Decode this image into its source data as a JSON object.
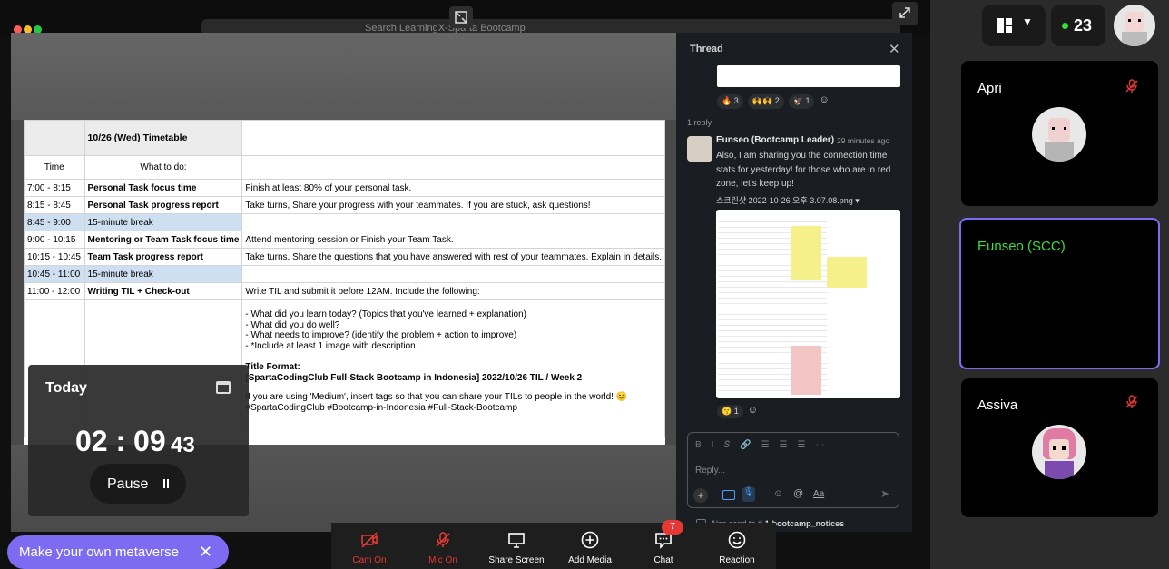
{
  "browser": {
    "address": "Search LearningX-Sparta Bootcamp"
  },
  "sheet": {
    "title": "10/26 (Wed) Timetable",
    "col_time": "Time",
    "col_what": "What to do:",
    "rows": [
      {
        "time": "7:00 - 8:15",
        "task": "Personal Task focus time",
        "detail": "Finish at least 80% of your personal task."
      },
      {
        "time": "8:15 - 8:45",
        "task": "Personal Task progress report",
        "detail": "Take turns, Share your progress with your teammates. If you are stuck, ask questions!"
      },
      {
        "time": "8:45 - 9:00",
        "task": "15-minute break",
        "detail": ""
      },
      {
        "time": "9:00 - 10:15",
        "task": "Mentoring or Team Task focus time",
        "detail": "Attend mentoring session or Finish your Team Task."
      },
      {
        "time": "10:15 - 10:45",
        "task": "Team Task progress report",
        "detail": "Take turns, Share the questions that you have answered with rest of your teammates. Explain in details."
      },
      {
        "time": "10:45 - 11:00",
        "task": "15-minute break",
        "detail": ""
      },
      {
        "time": "11:00 - 12:00",
        "task": "Writing TIL + Check-out",
        "detail": "Write TIL and submit it before 12AM. Include the following:"
      }
    ],
    "notes": [
      "- What did you learn today? (Topics that you've learned + explanation)",
      "- What did you do well?",
      "- What needs to improve? (identify the problem + action to improve)",
      "- *Include at least 1 image with description."
    ],
    "format_label": "Title Format:",
    "format_value": "[SpartaCodingClub Full-Stack Bootcamp in Indonesia] 2022/10/26 TIL / Week 2",
    "medium_note": "If you are using 'Medium', insert tags so that you can share your TILs to people in the world! 😊",
    "hashtags": "#SpartaCodingClub  #Bootcamp-in-Indonesia  #Full-Stack-Bootcamp"
  },
  "timer": {
    "label": "Today",
    "hm": "02 : 09",
    "sec": "43",
    "pause": "Pause"
  },
  "thread": {
    "title": "Thread",
    "reactions_top": [
      {
        "e": "🔥",
        "n": "3"
      },
      {
        "e": "🙌🙌",
        "n": "2"
      },
      {
        "e": "🦅",
        "n": "1"
      }
    ],
    "reply_count": "1 reply",
    "author": "Eunseo (Bootcamp Leader)",
    "time": "29 minutes ago",
    "message": "Also, I am sharing you the connection time stats for yesterday! for those who are in red zone, let's keep up!",
    "file": "스크린샷 2022-10-26 오후 3.07.08.png",
    "reaction_bottom": {
      "e": "😗",
      "n": "1"
    },
    "reply_placeholder": "Reply...",
    "also_send": "Also send to #",
    "channel": "1-bootcamp_notices"
  },
  "controls": [
    {
      "label": "Cam On",
      "color": "#e53935"
    },
    {
      "label": "Mic On",
      "color": "#e53935"
    },
    {
      "label": "Share Screen",
      "color": "#ffffff"
    },
    {
      "label": "Add Media",
      "color": "#ffffff"
    },
    {
      "label": "Chat",
      "color": "#ffffff",
      "badge": "7"
    },
    {
      "label": "Reaction",
      "color": "#ffffff"
    }
  ],
  "participants": {
    "count": "23"
  },
  "tiles": [
    {
      "name": "Apri",
      "color": "#ffffff"
    },
    {
      "name": "Eunseo (SCC)",
      "color": "#3ddc3d"
    },
    {
      "name": "Assiva",
      "color": "#ffffff"
    }
  ],
  "metaverse": "Make your own metaverse"
}
